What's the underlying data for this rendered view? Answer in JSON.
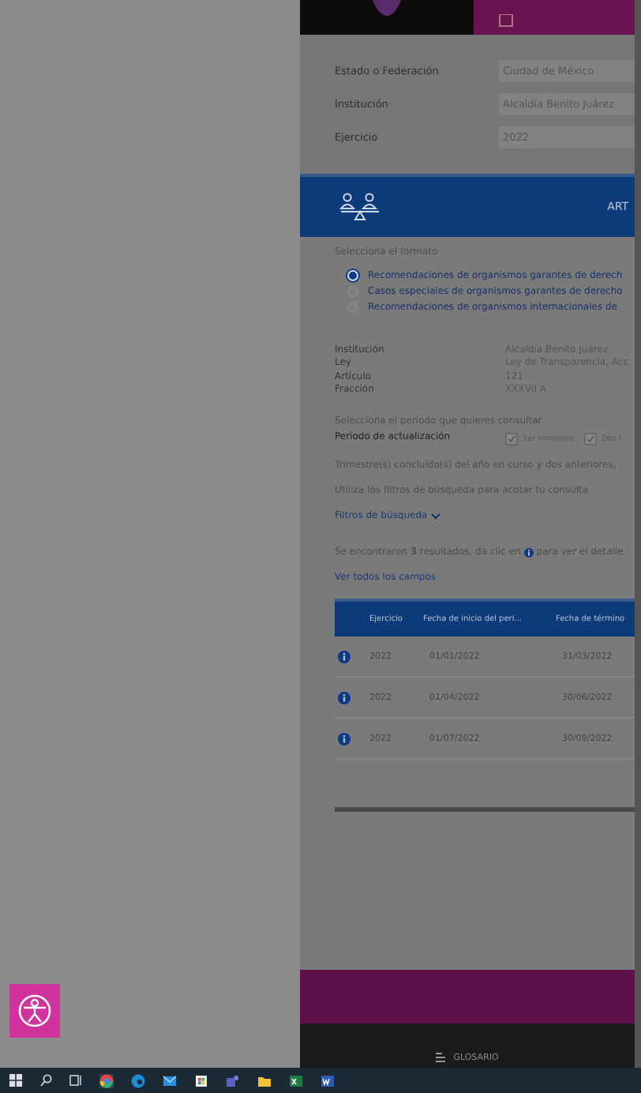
{
  "form": [
    {
      "label": "Estado o Federación",
      "value": "Ciudad de México"
    },
    {
      "label": "Institución",
      "value": "Alcaldía Benito Juárez"
    },
    {
      "label": "Ejercicio",
      "value": "2022"
    }
  ],
  "band": {
    "title": "ART"
  },
  "format": {
    "prompt": "Selecciona el formato",
    "options": [
      {
        "label": "Recomendaciones de organismos garantes de derech",
        "selected": true
      },
      {
        "label": "Casos especiales de organismos garantes de derecho",
        "selected": false
      },
      {
        "label": "Recomendaciones de organismos internacionales de",
        "selected": false
      }
    ]
  },
  "details": [
    {
      "label": "Institución",
      "value": "Alcaldía Benito Juárez"
    },
    {
      "label": "Ley",
      "value": "Ley de Transparencia, Acc"
    },
    {
      "label": "Artículo",
      "value": "121"
    },
    {
      "label": "Fracción",
      "value": "XXXVII A"
    }
  ],
  "period": {
    "prompt": "Selecciona el periodo que quieres consultar",
    "label": "Periodo de actualización",
    "quarters": [
      {
        "label": "1er trimestre",
        "checked": true
      },
      {
        "label": "2do t",
        "checked": true
      }
    ]
  },
  "note": "Trimestre(s) concluido(s) del año en curso y dos anteriores,",
  "hint": "Utiliza los filtros de búsqueda para acotar tu consulta",
  "filters_link": "Filtros de búsqueda",
  "results": {
    "before": "Se encontraron **3** resultados, da clic en",
    "after": "para ver el detalle"
  },
  "all_fields_link": "Ver todos los campos",
  "table": {
    "columns": [
      "Ejercicio",
      "Fecha de inicio del peri...",
      "Fecha de término"
    ],
    "rows": [
      [
        "2022",
        "01/01/2022",
        "31/03/2022"
      ],
      [
        "2022",
        "01/04/2022",
        "30/06/2022"
      ],
      [
        "2022",
        "01/07/2022",
        "30/09/2022"
      ]
    ]
  },
  "footer": {
    "link": "GLOSARIO"
  }
}
